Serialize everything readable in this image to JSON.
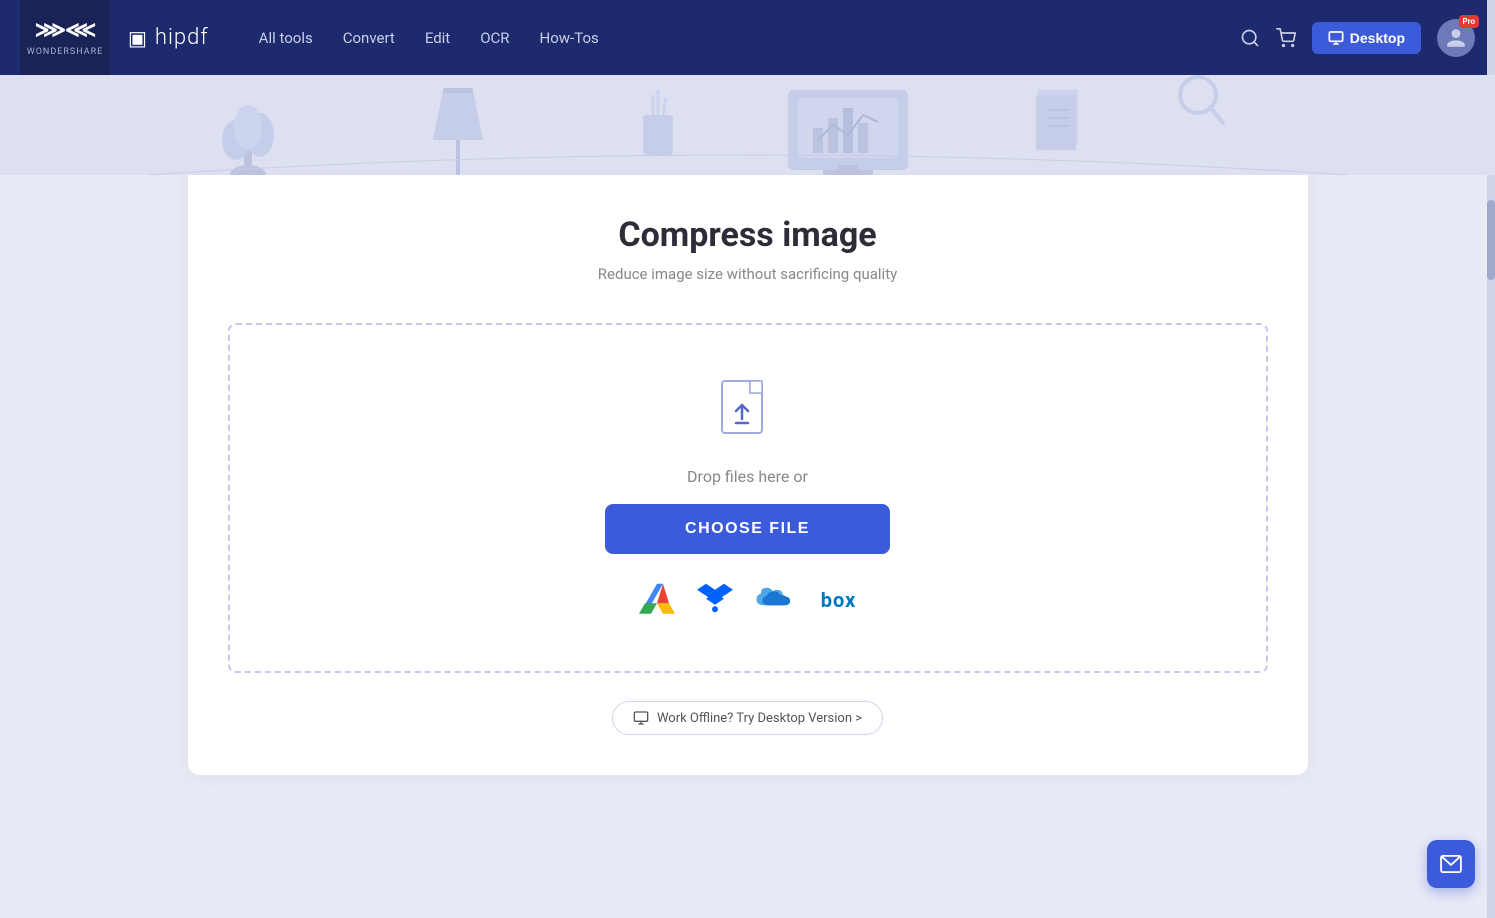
{
  "brand": {
    "ws_logo": "≋",
    "ws_name": "wondershare",
    "hipdf_name": "hipdf"
  },
  "navbar": {
    "links": [
      {
        "label": "All tools",
        "id": "all-tools"
      },
      {
        "label": "Convert",
        "id": "convert"
      },
      {
        "label": "Edit",
        "id": "edit"
      },
      {
        "label": "OCR",
        "id": "ocr"
      },
      {
        "label": "How-Tos",
        "id": "how-tos"
      }
    ],
    "desktop_btn": "Desktop",
    "pro_badge": "Pro"
  },
  "page": {
    "title": "Compress image",
    "subtitle": "Reduce image size without sacrificing quality"
  },
  "dropzone": {
    "drop_text": "Drop files here or",
    "choose_file_btn": "CHOOSE FILE",
    "cloud_services": [
      {
        "name": "Google Drive",
        "id": "gdrive"
      },
      {
        "name": "Dropbox",
        "id": "dropbox"
      },
      {
        "name": "OneDrive",
        "id": "onedrive"
      },
      {
        "name": "Box",
        "id": "box",
        "label": "box"
      }
    ]
  },
  "offline": {
    "text": "Work Offline? Try Desktop Version >"
  },
  "float_btn": {
    "label": "✉"
  }
}
